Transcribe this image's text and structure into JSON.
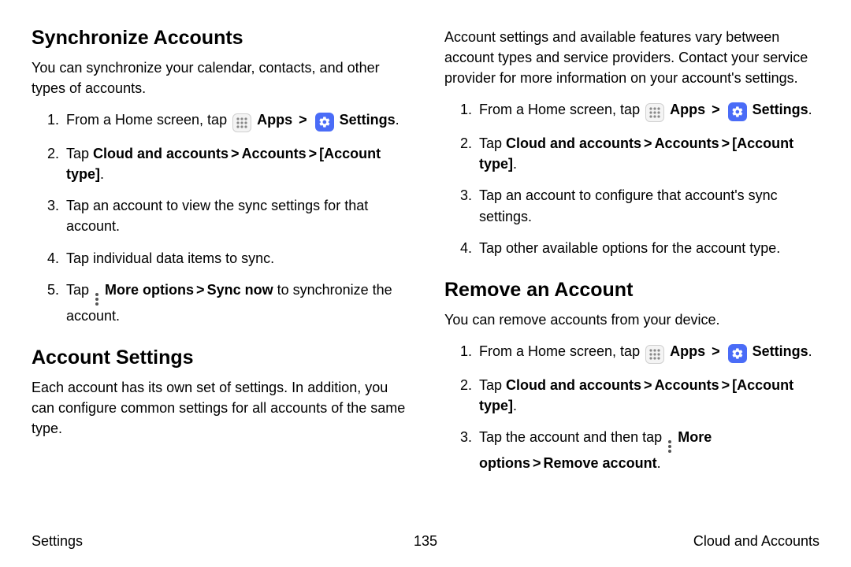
{
  "left": {
    "h_sync": "Synchronize Accounts",
    "p_sync": "You can synchronize your calendar, contacts, and other types of accounts.",
    "s1_a": "From a Home screen, tap ",
    "apps": "Apps",
    "settings": "Settings",
    "s2_a": "Tap ",
    "s2_b": "Cloud and accounts",
    "s2_c": "Accounts",
    "s2_d": "[Account type]",
    "s3": "Tap an account to view the sync settings for that account.",
    "s4": "Tap individual data items to sync.",
    "s5_a": "Tap ",
    "s5_b": "More options",
    "s5_c": "Sync now",
    "s5_d": " to synchronize the account.",
    "h_acct": "Account Settings",
    "p_acct": "Each account has its own set of settings. In addition, you can configure common settings for all accounts of the same type."
  },
  "right": {
    "p_top": "Account settings and available features vary between account types and service providers. Contact your service provider for more information on your account's settings.",
    "r3": "Tap an account to configure that account's sync settings.",
    "r4": "Tap other available options for the account type.",
    "h_remove": "Remove an Account",
    "p_remove": "You can remove accounts from your device.",
    "rm3_a": "Tap the account and then tap ",
    "rm3_b": "More options",
    "rm3_c": "Remove account"
  },
  "common": {
    "period": ".",
    "chev": ">"
  },
  "footer": {
    "left": "Settings",
    "page": "135",
    "right": "Cloud and Accounts"
  }
}
